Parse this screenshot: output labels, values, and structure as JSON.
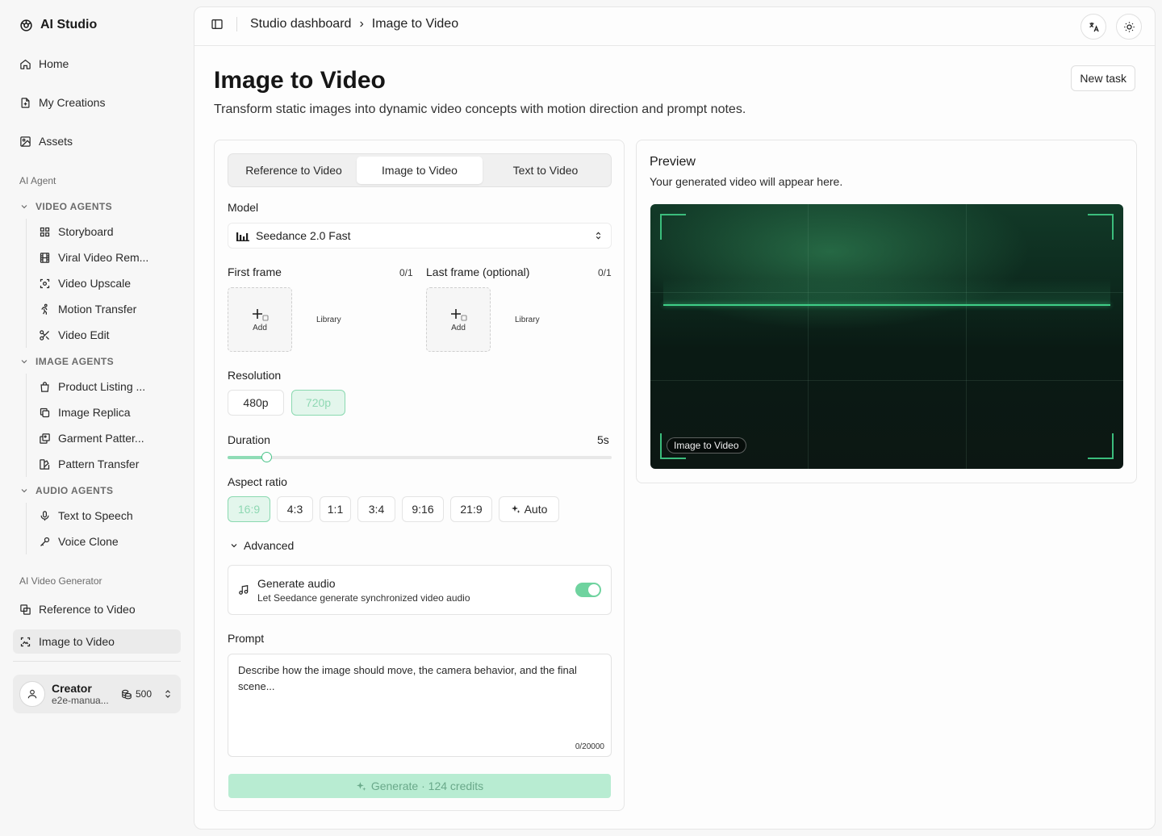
{
  "app": {
    "title": "AI Studio"
  },
  "sidebar": {
    "top_items": [
      {
        "label": "Home",
        "icon": "home-icon"
      },
      {
        "label": "My Creations",
        "icon": "document-icon"
      },
      {
        "label": "Assets",
        "icon": "image-icon"
      }
    ],
    "ai_agent_label": "AI Agent",
    "video_agents": {
      "label": "VIDEO AGENTS",
      "items": [
        "Storyboard",
        "Viral Video Rem...",
        "Video Upscale",
        "Motion Transfer",
        "Video Edit"
      ]
    },
    "image_agents": {
      "label": "IMAGE AGENTS",
      "items": [
        "Product Listing ...",
        "Image Replica",
        "Garment Patter...",
        "Pattern Transfer"
      ]
    },
    "audio_agents": {
      "label": "AUDIO AGENTS",
      "items": [
        "Text to Speech",
        "Voice Clone"
      ]
    },
    "generator_label": "AI Video Generator",
    "generator_items": [
      "Reference to Video",
      "Image to Video"
    ],
    "active_item": "Image to Video",
    "user": {
      "name": "Creator",
      "email": "e2e-manua...",
      "credits": "500"
    }
  },
  "header": {
    "breadcrumb": [
      "Studio dashboard",
      "Image to Video"
    ],
    "separator": "›"
  },
  "page": {
    "title": "Image to Video",
    "subtitle": "Transform static images into dynamic video concepts with motion direction and prompt notes.",
    "new_task_label": "New task"
  },
  "form": {
    "tabs": [
      "Reference to Video",
      "Image to Video",
      "Text to Video"
    ],
    "active_tab": "Image to Video",
    "model_label": "Model",
    "model_value": "Seedance 2.0 Fast",
    "first_frame": {
      "label": "First frame",
      "count": "0/1",
      "add_label": "Add",
      "library_label": "Library"
    },
    "last_frame": {
      "label": "Last frame (optional)",
      "count": "0/1",
      "add_label": "Add",
      "library_label": "Library"
    },
    "resolution_label": "Resolution",
    "resolutions": [
      "480p",
      "720p"
    ],
    "selected_resolution": "720p",
    "duration_label": "Duration",
    "duration_value": "5s",
    "duration_fraction": 0.1,
    "aspect_label": "Aspect ratio",
    "aspects": [
      "16:9",
      "4:3",
      "1:1",
      "3:4",
      "9:16",
      "21:9",
      "Auto"
    ],
    "selected_aspect": "16:9",
    "advanced_label": "Advanced",
    "audio": {
      "title": "Generate audio",
      "description": "Let Seedance generate synchronized video audio",
      "enabled": true
    },
    "prompt_label": "Prompt",
    "prompt_placeholder": "Describe how the image should move, the camera behavior, and the final scene...",
    "prompt_count": "0/20000",
    "generate_label": "Generate · 124 credits"
  },
  "preview": {
    "title": "Preview",
    "subtitle": "Your generated video will appear here.",
    "badge": "Image to Video"
  },
  "colors": {
    "accent": "#3fce87",
    "accent_soft": "#b8ecd2",
    "selected_chip_bg": "#e3f6ec",
    "active_nav_bg": "#ebebeb"
  }
}
